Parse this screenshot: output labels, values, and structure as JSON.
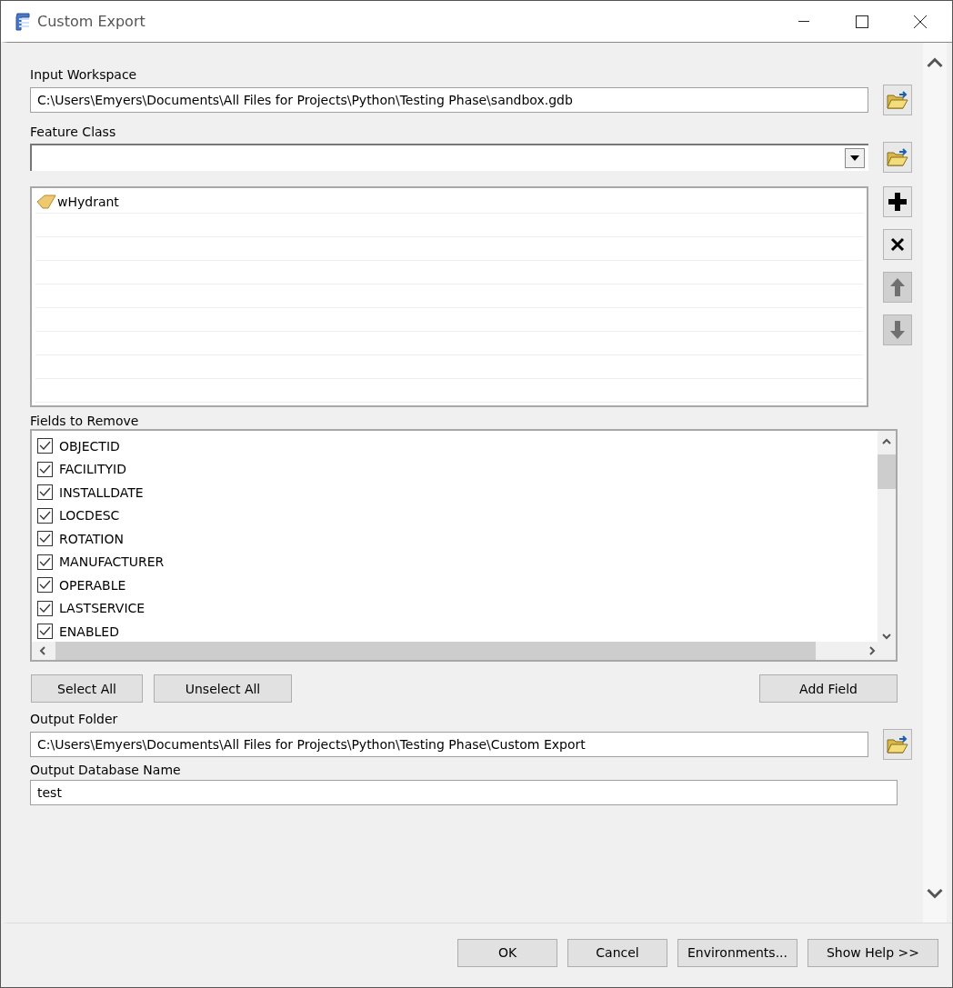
{
  "window": {
    "title": "Custom Export"
  },
  "input_workspace": {
    "label": "Input Workspace",
    "value": "C:\\Users\\Emyers\\Documents\\All Files for Projects\\Python\\Testing Phase\\sandbox.gdb"
  },
  "feature_class": {
    "label": "Feature Class",
    "items": [
      {
        "name": "wHydrant"
      }
    ],
    "tool_buttons": [
      {
        "kind": "add",
        "disabled": false
      },
      {
        "kind": "remove",
        "disabled": false
      },
      {
        "kind": "up",
        "disabled": true
      },
      {
        "kind": "down",
        "disabled": true
      }
    ]
  },
  "fields_to_remove": {
    "label": "Fields to Remove",
    "items": [
      {
        "name": "OBJECTID",
        "checked": true
      },
      {
        "name": "FACILITYID",
        "checked": true
      },
      {
        "name": "INSTALLDATE",
        "checked": true
      },
      {
        "name": "LOCDESC",
        "checked": true
      },
      {
        "name": "ROTATION",
        "checked": true
      },
      {
        "name": "MANUFACTURER",
        "checked": true
      },
      {
        "name": "OPERABLE",
        "checked": true
      },
      {
        "name": "LASTSERVICE",
        "checked": true
      },
      {
        "name": "ENABLED",
        "checked": true
      }
    ]
  },
  "field_buttons": [
    "Select All",
    "Unselect All",
    "Add Field"
  ],
  "output_folder": {
    "label": "Output Folder",
    "value": "C:\\Users\\Emyers\\Documents\\All Files for Projects\\Python\\Testing Phase\\Custom Export"
  },
  "output_database_name": {
    "label": "Output Database Name",
    "value": "test"
  },
  "buttons": [
    "OK",
    "Cancel",
    "Environments...",
    "Show Help >>"
  ]
}
